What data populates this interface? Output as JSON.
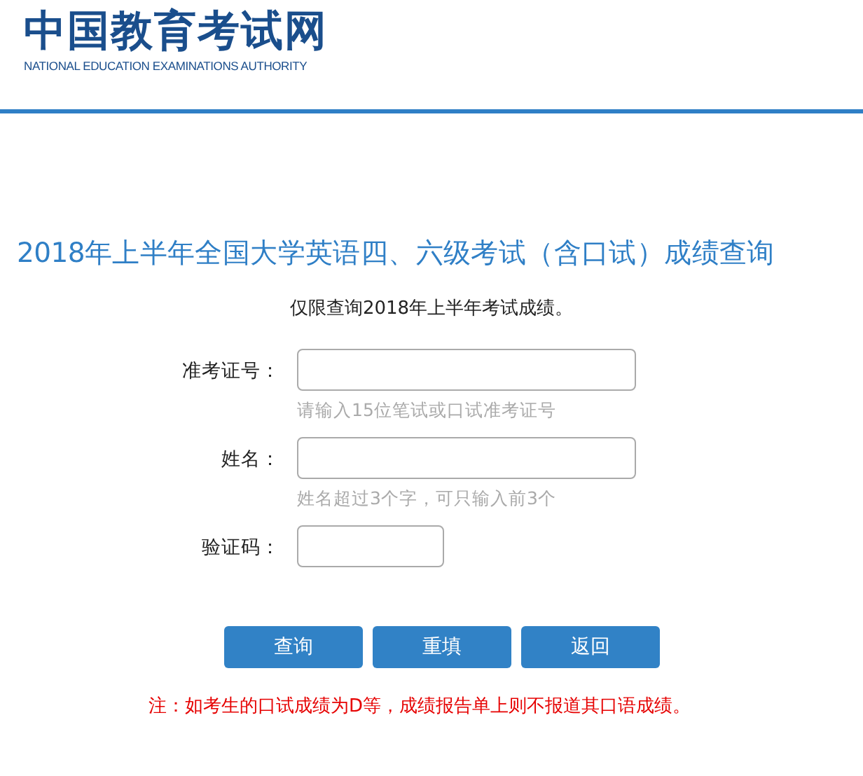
{
  "header": {
    "logo_title": "中国教育考试网",
    "logo_subtitle": "NATIONAL EDUCATION EXAMINATIONS AUTHORITY"
  },
  "page_title": "2018年上半年全国大学英语四、六级考试（含口试）成绩查询",
  "notice": "仅限查询2018年上半年考试成绩。",
  "fields": [
    {
      "label": "准考证号：",
      "hint": "请输入15位笔试或口试准考证号",
      "kind": "wide"
    },
    {
      "label": "姓名：",
      "hint": "姓名超过3个字，可只输入前3个",
      "kind": "wide"
    },
    {
      "label": "验证码：",
      "kind": "short"
    }
  ],
  "buttons": [
    "查询",
    "重填",
    "返回"
  ],
  "footnote": "注：如考生的口试成绩为D等，成绩报告单上则不报道其口语成绩。"
}
